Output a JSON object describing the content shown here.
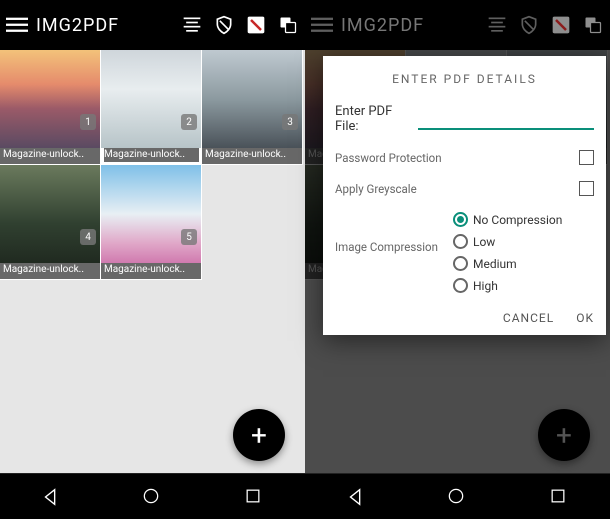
{
  "app": {
    "title": "IMG2PDF"
  },
  "colors": {
    "accent": "#0a8f7a"
  },
  "thumbs": [
    {
      "num": "1",
      "caption": "Magazine-unlock..",
      "cls": "sunset1",
      "selected": false
    },
    {
      "num": "2",
      "caption": "Magazine-unlock..",
      "cls": "snow1",
      "selected": true
    },
    {
      "num": "3",
      "caption": "Magazine-unlock..",
      "cls": "mtn1",
      "selected": false
    },
    {
      "num": "4",
      "caption": "Magazine-unlock..",
      "cls": "forest1",
      "selected": false
    },
    {
      "num": "5",
      "caption": "Magazine-unlock..",
      "cls": "fuji",
      "selected": false
    }
  ],
  "dialog": {
    "title": "ENTER PDF DETAILS",
    "file_label": "Enter PDF File:",
    "file_value": "",
    "password_label": "Password Protection",
    "password_checked": false,
    "greyscale_label": "Apply Greyscale",
    "greyscale_checked": false,
    "compression_label": "Image Compression",
    "compression_options": [
      {
        "label": "No Compression",
        "selected": true
      },
      {
        "label": "Low",
        "selected": false
      },
      {
        "label": "Medium",
        "selected": false
      },
      {
        "label": "High",
        "selected": false
      }
    ],
    "cancel": "CANCEL",
    "ok": "OK"
  },
  "icons": {
    "hamburger": "hamburger-icon",
    "align": "align-icon",
    "shield": "shield-icon",
    "pdf": "pdf-icon",
    "copy": "copy-icon",
    "fab": "+"
  }
}
